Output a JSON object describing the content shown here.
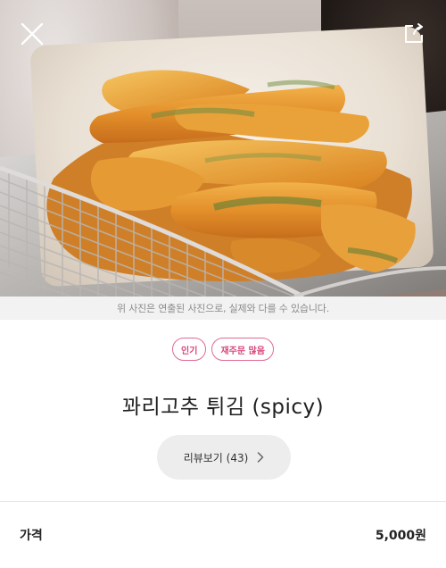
{
  "hero": {
    "close_icon": "close-icon",
    "share_icon": "share-icon"
  },
  "caption": "위 사진은 연출된 사진으로, 실제와 다를 수 있습니다.",
  "badges": [
    "인기",
    "재주문 많음"
  ],
  "menu": {
    "title": "꽈리고추 튀김 (spicy)"
  },
  "review": {
    "label": "리뷰보기 (43)",
    "icon": "chevron-right-icon"
  },
  "price": {
    "label": "가격",
    "value": "5,000원"
  },
  "colors": {
    "badge_accent": "#d9487e",
    "caption_bg": "#f2f2f2",
    "review_bg": "#ededed"
  }
}
